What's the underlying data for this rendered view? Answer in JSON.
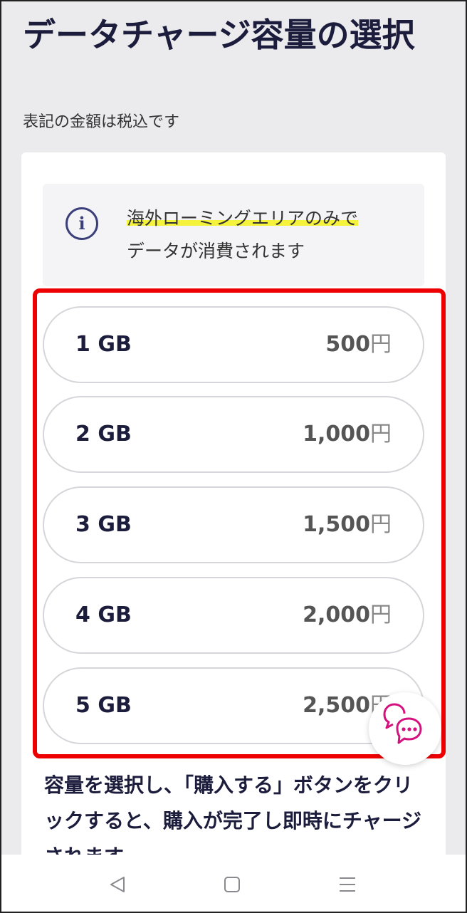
{
  "header": {
    "title": "データチャージ容量の選択",
    "tax_note": "表記の金額は税込です"
  },
  "info": {
    "highlighted_text": "海外ローミングエリアのみで",
    "rest_text": "データが消費されます",
    "icon": "info-icon"
  },
  "options": [
    {
      "capacity": "1 GB",
      "price": "500",
      "currency": "円"
    },
    {
      "capacity": "2 GB",
      "price": "1,000",
      "currency": "円"
    },
    {
      "capacity": "3 GB",
      "price": "1,500",
      "currency": "円"
    },
    {
      "capacity": "4 GB",
      "price": "2,000",
      "currency": "円"
    },
    {
      "capacity": "5 GB",
      "price": "2,500",
      "currency": "円"
    }
  ],
  "instruction": "容量を選択し、「購入する」ボタンをクリックすると、購入が完了し即時にチャージされます",
  "chat": {
    "icon": "chat-bubbles-icon",
    "color": "#d4117e"
  },
  "nav": {
    "back_icon": "back-triangle-icon",
    "home_icon": "home-square-icon",
    "menu_icon": "menu-lines-icon"
  },
  "colors": {
    "highlight_border": "#ee0000",
    "marker": "#f5f23b",
    "title": "#1c1c3c"
  }
}
